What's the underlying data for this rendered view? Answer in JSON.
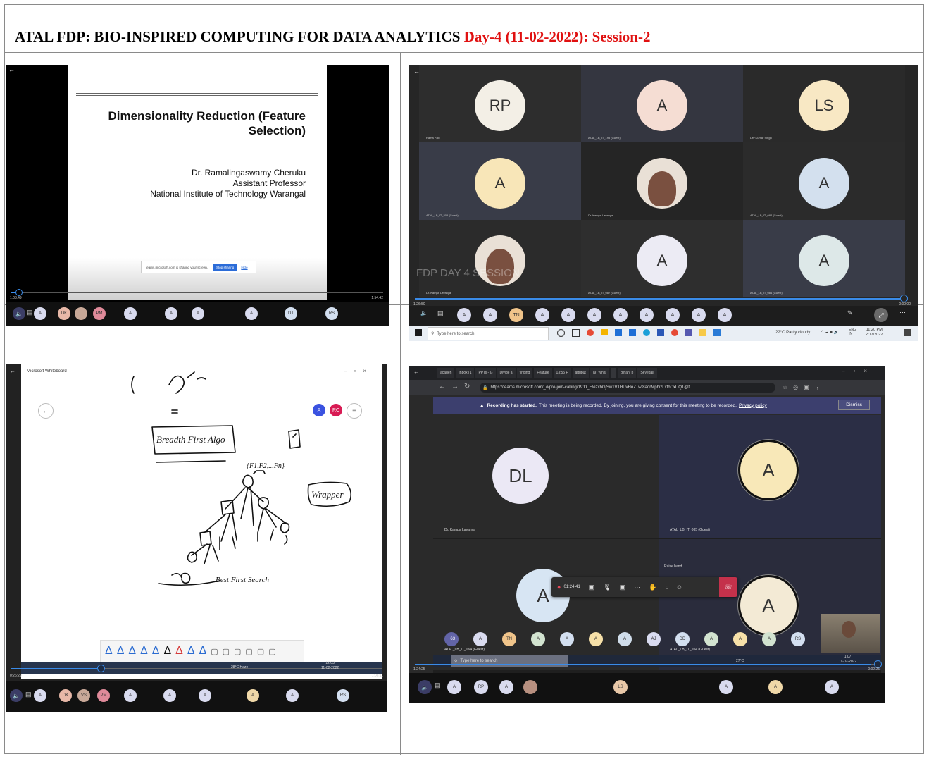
{
  "title": {
    "main": "ATAL FDP: BIO-INSPIRED COMPUTING FOR DATA ANALYTICS",
    "day": "Day-4 (11-02-2022): Session-2"
  },
  "shot1": {
    "slide_title": "Dimensionality Reduction (Feature Selection)",
    "slide_author": "Dr. Ramalingaswamy Cheruku",
    "slide_role": "Assistant Professor",
    "slide_org": "National Institute of Technology Warangal",
    "share_notice": "teams.microsoft.com is sharing your screen.",
    "stop_button": "Stop sharing",
    "hide_button": "Hide",
    "time_start": "1:03:49",
    "time_end": "1:54:42",
    "progress": 0.02,
    "avatars": [
      "A",
      "DK",
      "",
      "PM",
      "A",
      "A",
      "A",
      "A",
      "DT",
      "RS"
    ]
  },
  "shot2": {
    "tiles": [
      {
        "initials": "RP",
        "name": "Rama Patil",
        "color": "#f3efe6"
      },
      {
        "initials": "A",
        "name": "ATAL_LB_IT_195 (Guest)",
        "color": "#f5ddd3"
      },
      {
        "initials": "LS",
        "name": "Lav Kumar Singh",
        "color": "#f8e8c4"
      },
      {
        "initials": "A",
        "name": "ATAL_LB_IT_205 (Guest)",
        "color": "#f8e6b8"
      },
      {
        "initials": "",
        "name": "Dr. Kampa Lavanya",
        "color": "#e9e0d6"
      },
      {
        "initials": "A",
        "name": "ATAL_LB_IT_084 (Guest)",
        "color": "#d3e0ee"
      },
      {
        "initials": "",
        "name": "Dr. Kampa Lavanya",
        "color": "#e9e0d6"
      },
      {
        "initials": "A",
        "name": "ATAL_LB_IT_087 (Guest)",
        "color": "#ecebf4"
      },
      {
        "initials": "A",
        "name": "ATAL_LB_IT_084 (Guest)",
        "color": "#dde8e8"
      }
    ],
    "watermark": "FDP DAY 4 SESSION",
    "time_start": "1:26:50",
    "time_end": "0:00:00",
    "progress": 0.99,
    "bar_avatars": [
      "A",
      "A",
      "TN",
      "A",
      "A",
      "A",
      "A",
      "A",
      "A",
      "A",
      "A"
    ],
    "taskbar": {
      "search_placeholder": "Type here to search",
      "weather": "22°C  Partly cloudy",
      "lang": "ENG IN",
      "clock_time": "11:20 PM",
      "clock_date": "2/17/2022"
    }
  },
  "shot3": {
    "app_title": "Microsoft Whiteboard",
    "sketch_box": "Breadth First Algo",
    "sketch_right": "Wrapper",
    "sketch_bottom": "Best First Search",
    "time_start": "0:26:29",
    "time_end": "1:06:11",
    "progress": 0.24,
    "clock_time": "12:03",
    "clock_date": "11-02-2022",
    "weather": "28°C  Haze",
    "avatars": [
      "A",
      "DK",
      "VS",
      "PM",
      "A",
      "A",
      "A",
      "A",
      "A",
      "RS"
    ]
  },
  "shot4": {
    "url": "https://teams.microsoft.com/_#/pre-join-calling/19:D_E/ezxbGjSw1V1HUvHoZTwf8adrMpbizLxtbCxUQ1@t...",
    "tabs": [
      "acaden",
      "Inbox (1",
      "PPTs - G",
      "Divide a",
      "finding",
      "Feature",
      "13:55 F",
      "attribut",
      "(9) What",
      "",
      "Binary b",
      "Seyedali"
    ],
    "recording_banner": "Recording has started.",
    "recording_text": "This meeting is being recorded. By joining, you are giving consent for this meeting to be recorded.",
    "privacy_link": "Privacy policy",
    "dismiss": "Dismiss",
    "tiles": [
      {
        "initials": "DL",
        "name": "Dr. Kampa Lavanya",
        "color": "#ebe8f5"
      },
      {
        "initials": "A",
        "name": "ATAL_LB_IT_085 (Guest)",
        "color": "#f8e8b8"
      },
      {
        "initials": "A",
        "name": "ATAL_LB_IT_064 (Guest)",
        "color": "#d7e5f3"
      },
      {
        "initials": "A",
        "name": "ATAL_LB_IT_104 (Guest)",
        "color": "#f3ead5"
      }
    ],
    "raise_hand": "Raise hand",
    "call_timer": "01:24:41",
    "bar_avatars": [
      {
        "t": "+63",
        "c": "#6264a7"
      },
      {
        "t": "A",
        "c": "#d9dbef"
      },
      {
        "t": "TN",
        "c": "#f0c48a"
      },
      {
        "t": "A",
        "c": "#d2e3d0"
      },
      {
        "t": "A",
        "c": "#d3dff0"
      },
      {
        "t": "A",
        "c": "#f6e0a8"
      },
      {
        "t": "A",
        "c": "#d0ddea"
      },
      {
        "t": "AJ",
        "c": "#d9dbef"
      },
      {
        "t": "DD",
        "c": "#d3dff0"
      },
      {
        "t": "A",
        "c": "#d2e3d0"
      },
      {
        "t": "A",
        "c": "#f6e0a8"
      },
      {
        "t": "A",
        "c": "#d2e3d0"
      },
      {
        "t": "RS",
        "c": "#d3dff0"
      }
    ],
    "search_placeholder": "Type here to search",
    "time_start": "1:24:25",
    "time_end": "0:02:25",
    "progress": 0.98,
    "clock_time": "1:07",
    "clock_date": "11-02-2022",
    "weather": "27°C",
    "bottom_avatars": [
      "A",
      "RP",
      "A",
      "",
      "LS",
      "A",
      "A",
      "A"
    ]
  }
}
